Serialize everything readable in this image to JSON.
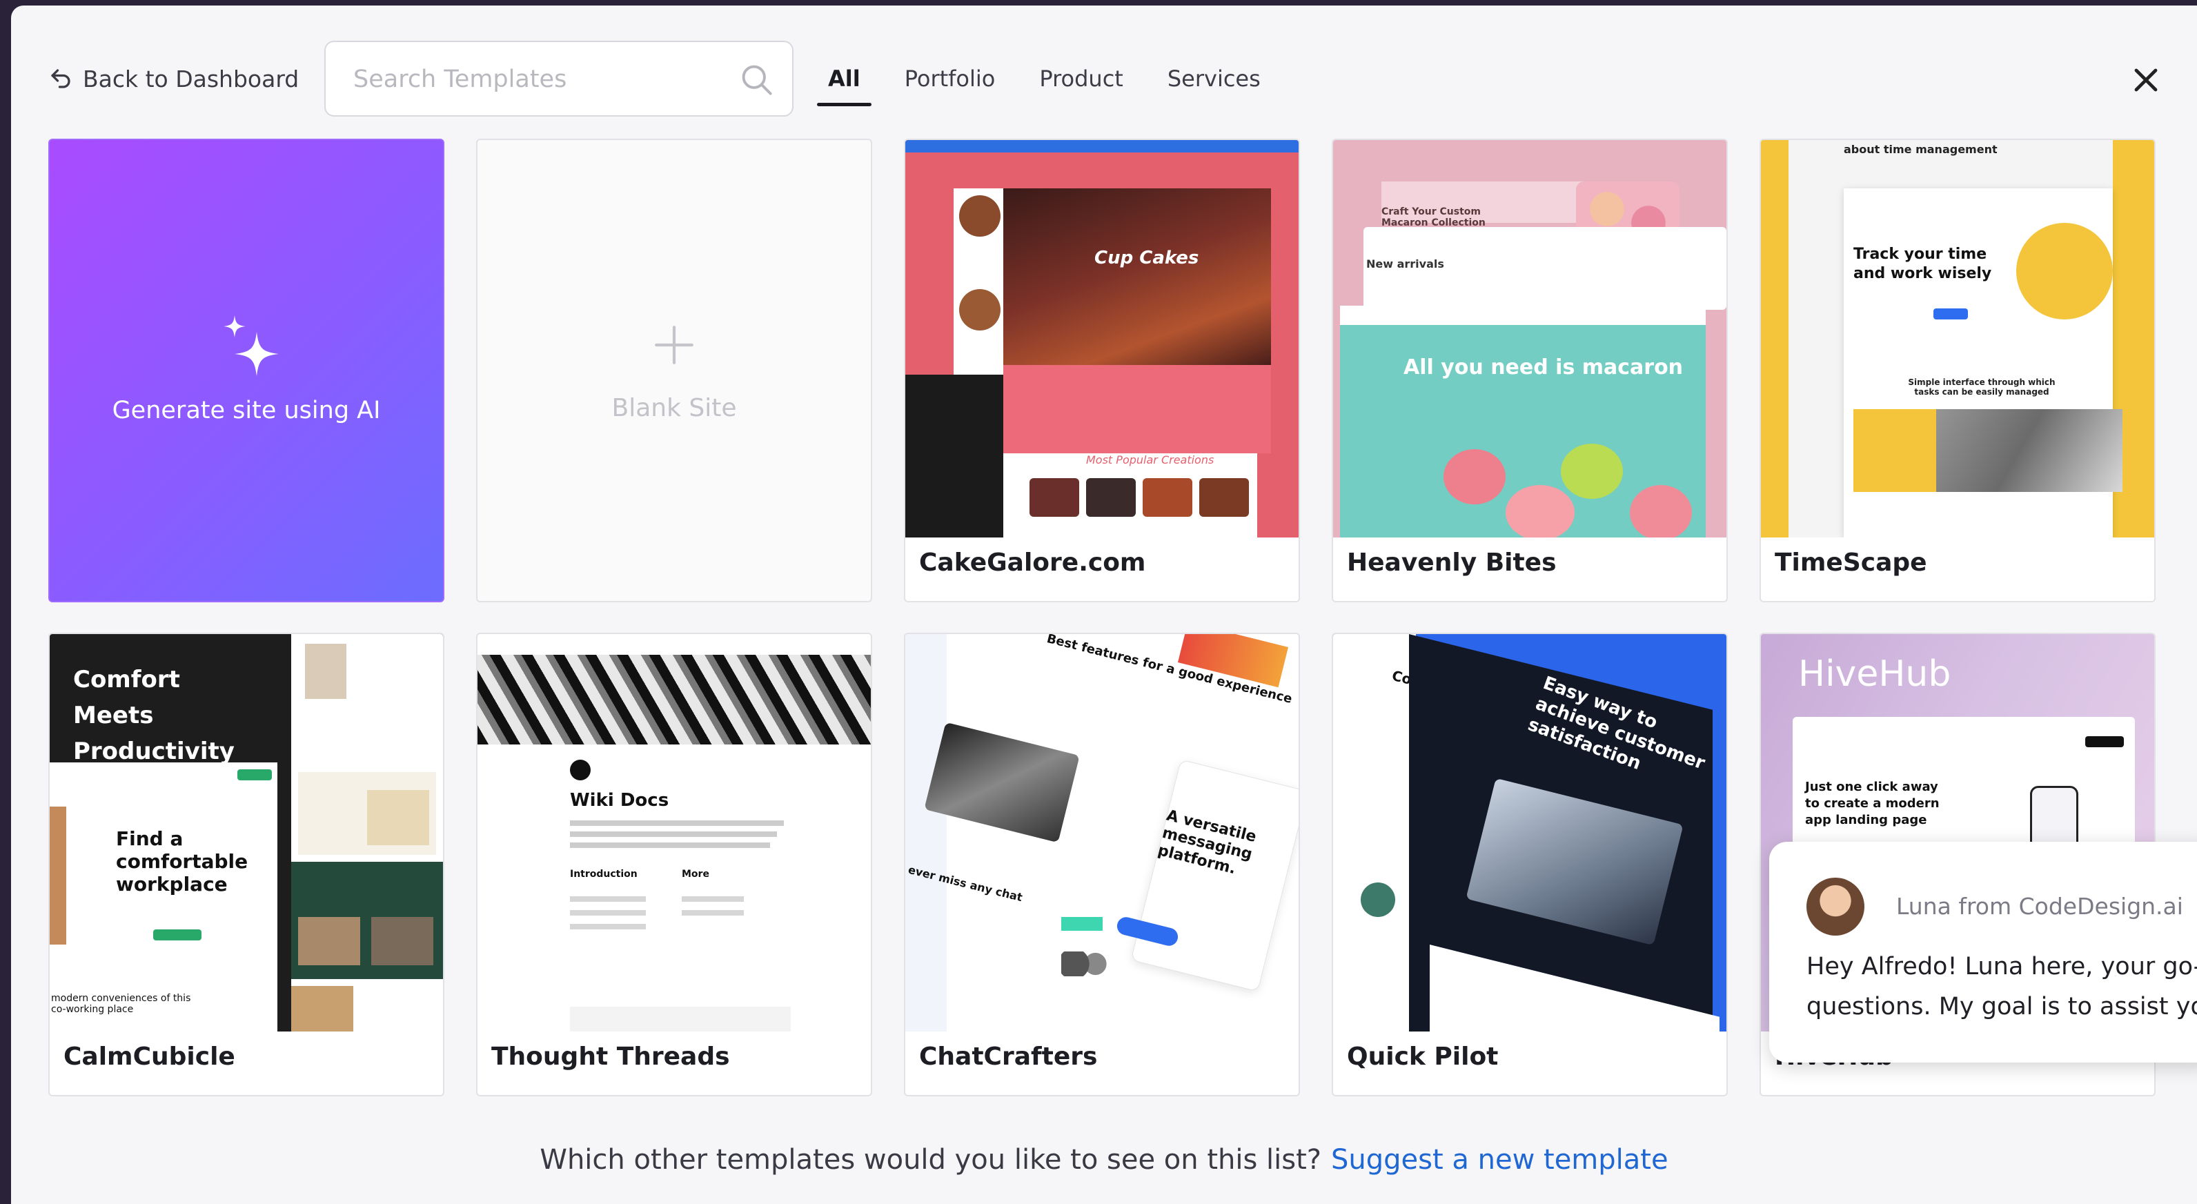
{
  "nav": {
    "back_label": "Back to Dashboard",
    "search_placeholder": "Search Templates",
    "tabs": [
      "All",
      "Portfolio",
      "Product",
      "Services"
    ],
    "active_tab": "All"
  },
  "special_cards": {
    "ai_label": "Generate site using AI",
    "blank_label": "Blank Site"
  },
  "templates": [
    {
      "name": "CakeGalore.com",
      "thumb_text": [
        "Cup Cakes",
        "Most Popular Creations"
      ]
    },
    {
      "name": "Heavenly Bites",
      "thumb_text": [
        "Craft Your Custom Macaron Collection",
        "New arrivals",
        "All you need is macaron"
      ]
    },
    {
      "name": "TimeScape",
      "thumb_text": [
        "about time management",
        "Track your time and work wisely",
        "Simple interface through which tasks can be easily managed"
      ]
    },
    {
      "name": "CalmCubicle",
      "thumb_text": [
        "Comfort Meets Productivity",
        "Find a comfortable workplace",
        "modern conveniences of this co-working place"
      ]
    },
    {
      "name": "Thought Threads",
      "thumb_text": [
        "Wiki Docs",
        "Introduction",
        "More"
      ]
    },
    {
      "name": "ChatCrafters",
      "thumb_text": [
        "Best features for a good experience",
        "A versatile messaging platform.",
        "ever miss any chat"
      ]
    },
    {
      "name": "Quick Pilot",
      "thumb_text": [
        "Contact us",
        "Easy way to achieve customer satisfaction"
      ]
    },
    {
      "name": "HiveHub",
      "thumb_text": [
        "HiveHub",
        "Just one click away to create a modern app landing page"
      ]
    }
  ],
  "footer": {
    "question": "Which other templates would you like to see on this list?",
    "link": "Suggest a new template"
  },
  "chat": {
    "from": "Luna from CodeDesign.ai",
    "line1": "Hey Alfredo! Luna here, your go-to",
    "line2": "questions. My goal is to assist you"
  },
  "colors": {
    "accent_link": "#1f67d2",
    "ai_gradient": [
      "#a94bff",
      "#6c6dff"
    ]
  }
}
